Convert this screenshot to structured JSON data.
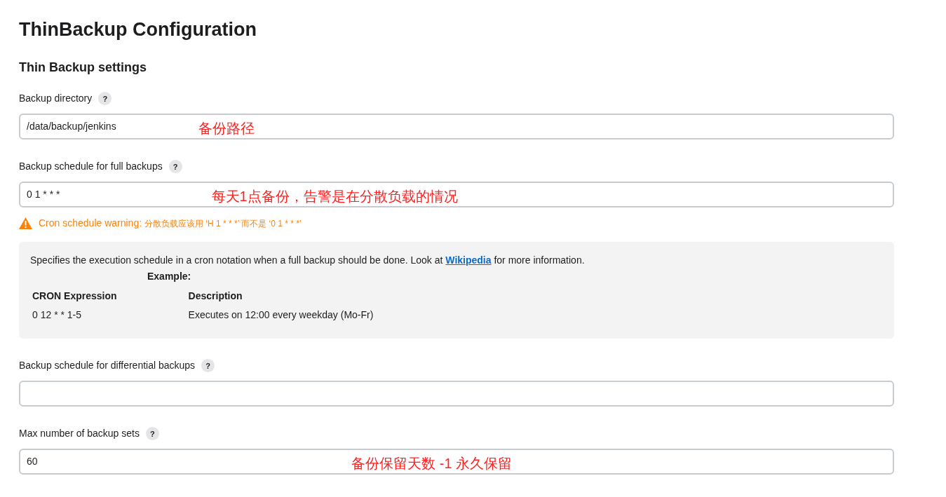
{
  "title": "ThinBackup Configuration",
  "section": "Thin Backup settings",
  "fields": [
    {
      "label": "Backup directory",
      "help": "?",
      "value": "/data/backup/jenkins",
      "annotation": "备份路径"
    },
    {
      "label": "Backup schedule for full backups",
      "help": "?",
      "value": "0 1 * * *",
      "annotation": "每天1点备份，告警是在分散负载的情况",
      "warning": {
        "prefix": "Cron schedule warning:",
        "text": "分散负载应该用 ‘H 1 * * *’ 而不是 ‘0 1 * * *’"
      },
      "info": {
        "before": "Specifies the execution schedule in a cron notation when a full backup should be done. Look at ",
        "link": "Wikipedia",
        "after": " for more information.",
        "example": "Example:",
        "columns": [
          "CRON Expression",
          "Description"
        ],
        "rows": [
          [
            "0 12 * * 1-5",
            "Executes on 12:00 every weekday (Mo-Fr)"
          ]
        ]
      }
    },
    {
      "label": "Backup schedule for differential backups",
      "help": "?"
    },
    {
      "label": "Max number of backup sets",
      "help": "?",
      "value": "60",
      "annotation": "备份保留天数 -1 永久保留"
    }
  ]
}
